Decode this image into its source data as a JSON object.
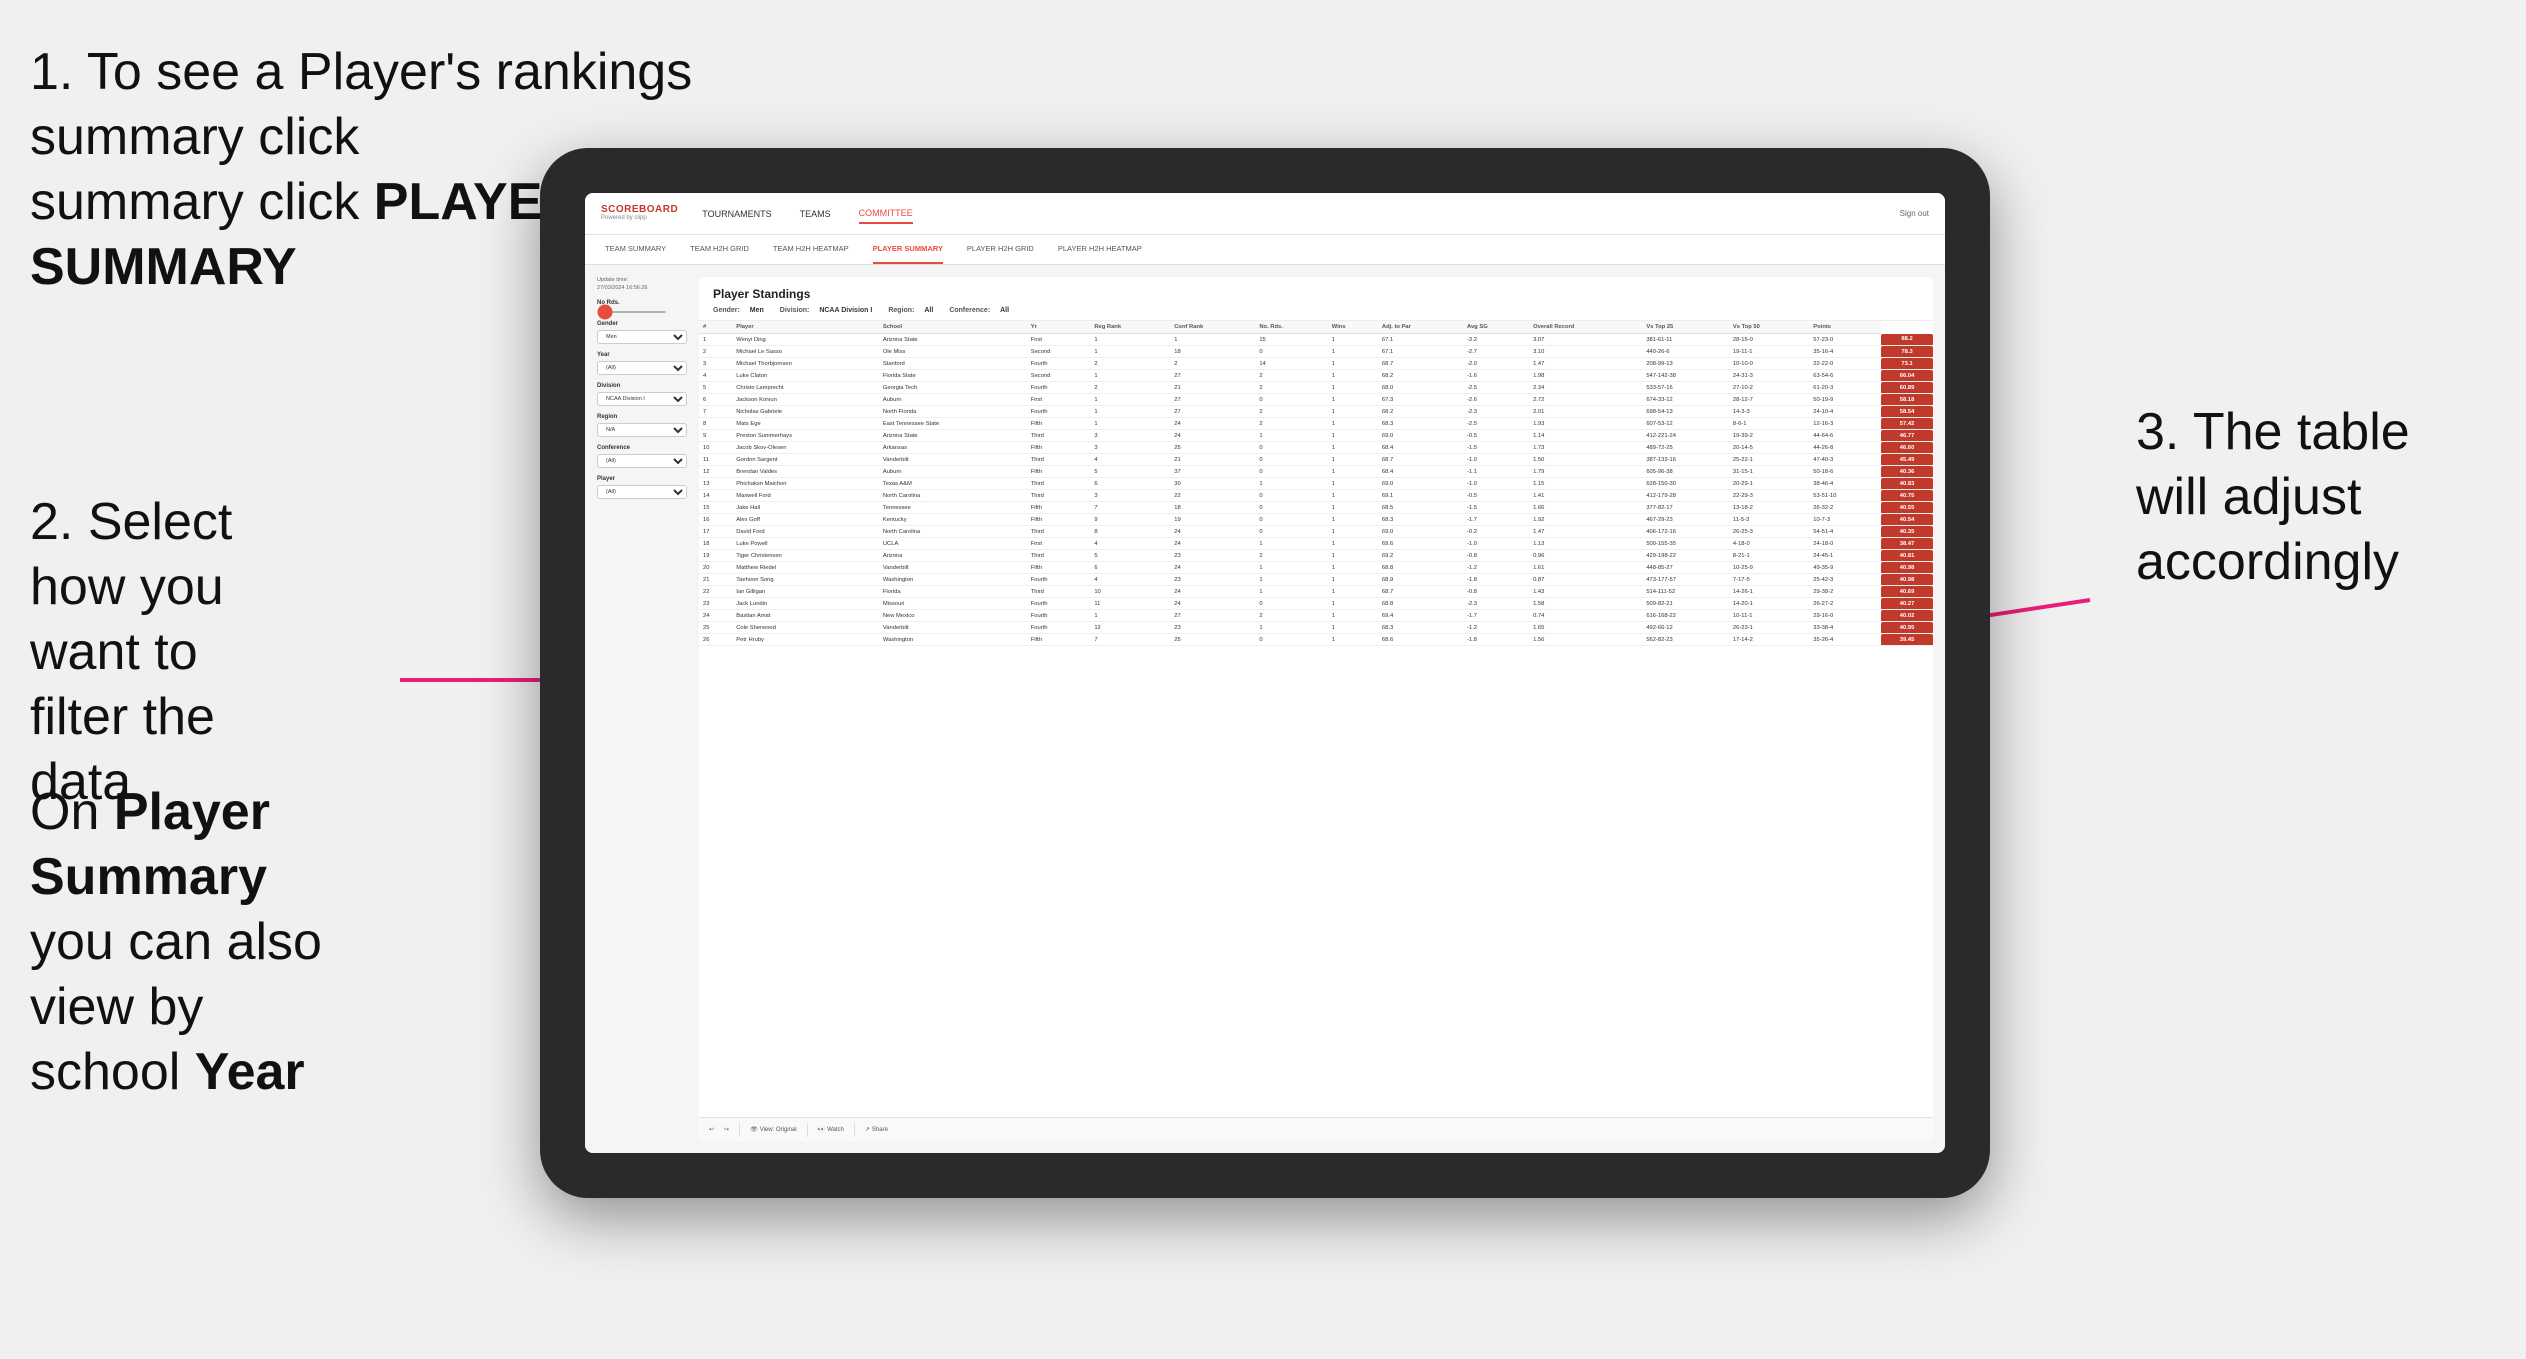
{
  "instructions": {
    "step1": "1. To see a Player's rankings summary click ",
    "step1_bold": "PLAYER SUMMARY",
    "step2_title": "2. Select how you want to filter the data",
    "step2_note_prefix": "On ",
    "step2_note_bold": "Player Summary",
    "step2_note_suffix": " you can also view by school ",
    "step2_year_bold": "Year",
    "step3": "3. The table will adjust accordingly"
  },
  "app": {
    "logo": "SCOREBOARD",
    "logo_sub": "Powered by clipp",
    "sign_out": "Sign out"
  },
  "nav": {
    "items": [
      "TOURNAMENTS",
      "TEAMS",
      "COMMITTEE"
    ]
  },
  "sub_nav": {
    "items": [
      "TEAM SUMMARY",
      "TEAM H2H GRID",
      "TEAM H2H HEATMAP",
      "PLAYER SUMMARY",
      "PLAYER H2H GRID",
      "PLAYER H2H HEATMAP"
    ]
  },
  "table": {
    "title": "Player Standings",
    "update_time": "Update time:\n27/03/2024 16:56:26",
    "filters": {
      "gender_label": "Gender:",
      "gender_value": "Men",
      "division_label": "Division:",
      "division_value": "NCAA Division I",
      "region_label": "Region:",
      "region_value": "All",
      "conference_label": "Conference:",
      "conference_value": "All"
    },
    "no_rds_label": "No Rds.",
    "sidebar_filters": [
      {
        "label": "Gender",
        "value": "Men"
      },
      {
        "label": "Year",
        "value": "(All)"
      },
      {
        "label": "Division",
        "value": "NCAA Division I"
      },
      {
        "label": "Region",
        "value": "N/A"
      },
      {
        "label": "Conference",
        "value": "(All)"
      },
      {
        "label": "Player",
        "value": "(All)"
      }
    ],
    "columns": [
      "#",
      "Player",
      "School",
      "Yr",
      "Reg Rank",
      "Conf Rank",
      "No. Rds.",
      "Wins",
      "Adj. to Par",
      "Avg SG",
      "Overall Record",
      "Vs Top 25",
      "Vs Top 50",
      "Points"
    ],
    "rows": [
      [
        "1",
        "Wenyi Ding",
        "Arizona State",
        "First",
        "1",
        "1",
        "15",
        "1",
        "67.1",
        "-3.2",
        "3.07",
        "381-61-11",
        "28-15-0",
        "57-23-0",
        "88.2"
      ],
      [
        "2",
        "Michael Le Sasso",
        "Ole Miss",
        "Second",
        "1",
        "18",
        "0",
        "1",
        "67.1",
        "-2.7",
        "3.10",
        "440-26-6",
        "19-11-1",
        "35-16-4",
        "78.3"
      ],
      [
        "3",
        "Michael Thorbjornsen",
        "Stanford",
        "Fourth",
        "2",
        "2",
        "14",
        "1",
        "68.7",
        "-2.0",
        "1.47",
        "208-99-13",
        "10-10-0",
        "22-22-0",
        "73.1"
      ],
      [
        "4",
        "Luke Claton",
        "Florida State",
        "Second",
        "1",
        "27",
        "2",
        "1",
        "68.2",
        "-1.6",
        "1.98",
        "547-142-38",
        "24-31-3",
        "63-54-6",
        "66.04"
      ],
      [
        "5",
        "Christo Lamprecht",
        "Georgia Tech",
        "Fourth",
        "2",
        "21",
        "2",
        "1",
        "68.0",
        "-2.5",
        "2.34",
        "533-57-16",
        "27-10-2",
        "61-20-3",
        "60.89"
      ],
      [
        "6",
        "Jackson Koivun",
        "Auburn",
        "First",
        "1",
        "27",
        "0",
        "1",
        "67.3",
        "-2.6",
        "2.72",
        "674-33-12",
        "28-12-7",
        "50-19-9",
        "58.18"
      ],
      [
        "7",
        "Nicholas Gabriele",
        "North Florida",
        "Fourth",
        "1",
        "27",
        "2",
        "1",
        "68.2",
        "-2.3",
        "2.01",
        "698-54-13",
        "14-3-3",
        "24-10-4",
        "58.54"
      ],
      [
        "8",
        "Mats Ege",
        "East Tennessee State",
        "Fifth",
        "1",
        "24",
        "2",
        "1",
        "68.3",
        "-2.5",
        "1.93",
        "607-53-12",
        "8-6-1",
        "12-16-3",
        "57.42"
      ],
      [
        "9",
        "Preston Summerhays",
        "Arizona State",
        "Third",
        "3",
        "24",
        "1",
        "1",
        "69.0",
        "-0.5",
        "1.14",
        "412-221-24",
        "19-39-2",
        "44-64-6",
        "46.77"
      ],
      [
        "10",
        "Jacob Skov-Olesen",
        "Arkansas",
        "Fifth",
        "3",
        "25",
        "0",
        "1",
        "68.4",
        "-1.5",
        "1.73",
        "489-72-25",
        "20-14-5",
        "44-26-8",
        "46.60"
      ],
      [
        "11",
        "Gordon Sargent",
        "Vanderbilt",
        "Third",
        "4",
        "21",
        "0",
        "1",
        "68.7",
        "-1.0",
        "1.50",
        "387-133-16",
        "25-22-1",
        "47-40-3",
        "45.49"
      ],
      [
        "12",
        "Brendan Valdes",
        "Auburn",
        "Fifth",
        "5",
        "37",
        "0",
        "1",
        "68.4",
        "-1.1",
        "1.79",
        "605-96-38",
        "31-15-1",
        "50-18-6",
        "40.36"
      ],
      [
        "13",
        "Phichaksn Maichon",
        "Texas A&M",
        "Third",
        "6",
        "30",
        "1",
        "1",
        "69.0",
        "-1.0",
        "1.15",
        "628-150-30",
        "20-29-1",
        "38-46-4",
        "40.83"
      ],
      [
        "14",
        "Maxwell Ford",
        "North Carolina",
        "Third",
        "3",
        "22",
        "0",
        "1",
        "69.1",
        "-0.5",
        "1.41",
        "412-179-28",
        "22-29-3",
        "53-51-10",
        "40.75"
      ],
      [
        "15",
        "Jake Hall",
        "Tennessee",
        "Fifth",
        "7",
        "18",
        "0",
        "1",
        "68.5",
        "-1.5",
        "1.66",
        "377-82-17",
        "13-18-2",
        "26-32-2",
        "40.55"
      ],
      [
        "16",
        "Alex Goff",
        "Kentucky",
        "Fifth",
        "9",
        "19",
        "0",
        "1",
        "68.3",
        "-1.7",
        "1.92",
        "467-29-23",
        "11-5-3",
        "10-7-3",
        "40.54"
      ],
      [
        "17",
        "David Ford",
        "North Carolina",
        "Third",
        "8",
        "24",
        "0",
        "1",
        "69.0",
        "-0.2",
        "1.47",
        "406-172-16",
        "26-25-3",
        "54-51-4",
        "40.35"
      ],
      [
        "18",
        "Luke Powell",
        "UCLA",
        "First",
        "4",
        "24",
        "1",
        "1",
        "69.6",
        "-1.0",
        "1.13",
        "500-155-35",
        "4-18-0",
        "24-18-0",
        "38.47"
      ],
      [
        "19",
        "Tiger Christensen",
        "Arizona",
        "Third",
        "5",
        "23",
        "2",
        "1",
        "69.2",
        "-0.8",
        "0.96",
        "429-198-22",
        "8-21-1",
        "24-45-1",
        "40.81"
      ],
      [
        "20",
        "Matthew Riedel",
        "Vanderbilt",
        "Fifth",
        "6",
        "24",
        "1",
        "1",
        "68.8",
        "-1.2",
        "1.61",
        "448-85-27",
        "10-25-9",
        "49-35-9",
        "40.98"
      ],
      [
        "21",
        "Taehoon Song",
        "Washington",
        "Fourth",
        "4",
        "23",
        "1",
        "1",
        "68.9",
        "-1.8",
        "0.87",
        "473-177-57",
        "7-17-5",
        "25-42-3",
        "40.98"
      ],
      [
        "22",
        "Ian Gilligan",
        "Florida",
        "Third",
        "10",
        "24",
        "1",
        "1",
        "68.7",
        "-0.8",
        "1.43",
        "514-111-52",
        "14-26-1",
        "29-38-2",
        "40.69"
      ],
      [
        "23",
        "Jack Lundin",
        "Missouri",
        "Fourth",
        "11",
        "24",
        "0",
        "1",
        "68.8",
        "-2.3",
        "1.58",
        "509-82-21",
        "14-20-1",
        "26-27-2",
        "40.27"
      ],
      [
        "24",
        "Bastian Amat",
        "New Mexico",
        "Fourth",
        "1",
        "27",
        "2",
        "1",
        "69.4",
        "-1.7",
        "0.74",
        "616-168-22",
        "10-11-1",
        "29-16-0",
        "40.02"
      ],
      [
        "25",
        "Cole Sherwood",
        "Vanderbilt",
        "Fourth",
        "12",
        "23",
        "1",
        "1",
        "68.3",
        "-1.2",
        "1.65",
        "492-66-12",
        "26-23-1",
        "33-38-4",
        "40.95"
      ],
      [
        "26",
        "Petr Hruby",
        "Washington",
        "Fifth",
        "7",
        "25",
        "0",
        "1",
        "68.6",
        "-1.8",
        "1.56",
        "562-82-23",
        "17-14-2",
        "35-26-4",
        "39.45"
      ]
    ]
  },
  "toolbar": {
    "view_label": "View: Original",
    "watch_label": "Watch",
    "share_label": "Share"
  }
}
